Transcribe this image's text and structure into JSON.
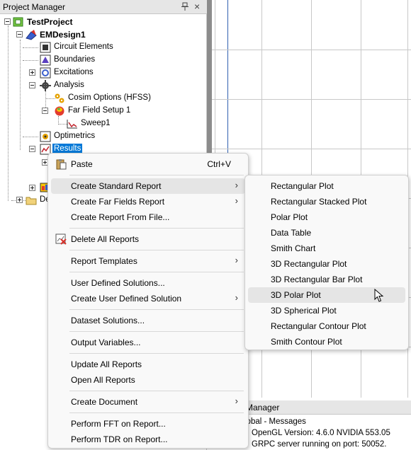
{
  "project_manager": {
    "title": "Project Manager",
    "pin_icon": "pin-icon",
    "close_label": "×",
    "tree": {
      "project": "TestProject",
      "design": "EMDesign1",
      "circuit_elements": "Circuit Elements",
      "boundaries": "Boundaries",
      "excitations": "Excitations",
      "analysis": "Analysis",
      "cosim_options": "Cosim Options (HFSS)",
      "far_field_setup": "Far Field Setup 1",
      "sweep": "Sweep1",
      "optimetrics": "Optimetrics",
      "results": "Results",
      "definitions_partial": "De"
    }
  },
  "message_manager": {
    "title_partial": "Manager",
    "group_partial": "lobal - Messages",
    "lines": [
      "OpenGL Version: 4.6.0 NVIDIA 553.05",
      "GRPC server running on port: 50052."
    ]
  },
  "context_menu": {
    "items": [
      {
        "label": "Paste",
        "shortcut": "Ctrl+V"
      },
      {
        "label": "Create Standard Report",
        "arrow": "›"
      },
      {
        "label": "Create Far Fields Report",
        "arrow": "›"
      },
      {
        "label": "Create Report From File..."
      },
      {
        "label": "Delete All Reports"
      },
      {
        "label": "Report Templates",
        "arrow": "›"
      },
      {
        "label": "User Defined Solutions..."
      },
      {
        "label": "Create User Defined Solution",
        "arrow": "›"
      },
      {
        "label": "Dataset Solutions..."
      },
      {
        "label": "Output Variables..."
      },
      {
        "label": "Update All Reports"
      },
      {
        "label": "Open All Reports"
      },
      {
        "label": "Create Document",
        "arrow": "›"
      },
      {
        "label": "Perform FFT on Report..."
      },
      {
        "label": "Perform TDR on Report..."
      }
    ]
  },
  "submenu": {
    "items": [
      "Rectangular Plot",
      "Rectangular Stacked Plot",
      "Polar Plot",
      "Data Table",
      "Smith Chart",
      "3D Rectangular Plot",
      "3D Rectangular Bar Plot",
      "3D Polar Plot",
      "3D Spherical Plot",
      "Rectangular Contour Plot",
      "Smith Contour Plot"
    ],
    "hovered": "3D Polar Plot"
  },
  "colors": {
    "selection": "#0078d7",
    "menu_bg": "#f9f9f9",
    "menu_hover": "#e5e5e5",
    "splitter": "#8c8c8c"
  }
}
